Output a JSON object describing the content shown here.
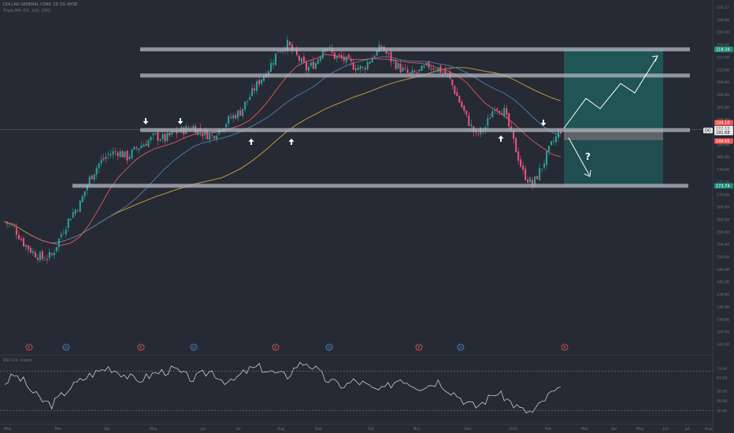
{
  "header": {
    "symbol_line": "DOLLAR GENERAL CORP. 1D  DG  NYSE",
    "indicator_line": "Triple MA  (50, 100, 200)"
  },
  "rsi_header": "RSI  (14, close)",
  "colors": {
    "background": "#262a34",
    "up": "#26a69a",
    "down": "#ef5381",
    "ma50": "#e05a5a",
    "ma100": "#4a7fb5",
    "ma200": "#d4a03c",
    "zone": "#1f5a58",
    "level_band": "#b4b8c0",
    "arrow": "#ffffff"
  },
  "price_axis_ticks": [
    "232.17",
    "228.00",
    "224.00",
    "220.00",
    "217.00",
    "213.00",
    "209.00",
    "205.00",
    "201.00",
    "198.00",
    "190.00",
    "186.00",
    "182.00",
    "179.00",
    "175.00",
    "170.00",
    "166.00",
    "162.00",
    "158.00",
    "154.00",
    "150.00",
    "146.00",
    "142.00",
    "138.00",
    "134.00",
    "130.00",
    "126.00",
    "122.00"
  ],
  "price_labels": [
    {
      "text": "218.34",
      "kind": "green"
    },
    {
      "text": "194.10",
      "kind": "red"
    },
    {
      "text": "192.16",
      "kind": "light"
    },
    {
      "text": "DG",
      "kind": "light"
    },
    {
      "text": "191.96",
      "kind": "light"
    },
    {
      "text": "191.68",
      "kind": "light"
    },
    {
      "text": "188.65",
      "kind": "red"
    },
    {
      "text": "173.74",
      "kind": "green"
    }
  ],
  "rsi_axis_ticks": [
    "73.00",
    "63.50",
    "50.00",
    "40.00",
    "30.00"
  ],
  "time_axis_ticks": [
    "May",
    "Mar",
    "Apr",
    "May",
    "Jun",
    "Jul",
    "Aug",
    "Sep",
    "Oct",
    "Nov",
    "Dec",
    "2021",
    "Feb",
    "Mar",
    "Apr",
    "May",
    "Jun",
    "Jul",
    "Aug"
  ],
  "event_markers": [
    "E",
    "D",
    "E",
    "D",
    "E",
    "D",
    "E",
    "D",
    "E"
  ],
  "question_mark": "?",
  "chart_data": {
    "type": "candlestick",
    "title": "DOLLAR GENERAL CORP. 1D",
    "series": [
      {
        "name": "DG",
        "close": [
          162,
          160,
          155,
          152,
          150,
          151,
          158,
          164,
          168,
          176,
          181,
          184,
          185,
          183,
          186,
          188,
          190,
          189,
          191,
          192,
          193,
          191,
          190,
          193,
          196,
          198,
          203,
          208,
          212,
          218,
          220,
          216,
          212,
          214,
          220,
          216,
          215,
          213,
          212,
          216,
          219,
          215,
          212,
          210,
          211,
          213,
          212,
          210,
          203,
          196,
          190,
          193,
          200,
          198,
          188,
          178,
          174,
          180,
          187,
          192
        ]
      },
      {
        "name": "MA 50"
      },
      {
        "name": "MA 100"
      },
      {
        "name": "MA 200"
      },
      {
        "name": "RSI",
        "values": [
          58,
          66,
          60,
          48,
          40,
          36,
          45,
          54,
          60,
          66,
          70,
          74,
          70,
          65,
          60,
          64,
          68,
          70,
          72,
          66,
          62,
          67,
          70,
          62,
          58,
          66,
          72,
          74,
          70,
          67,
          65,
          76,
          79,
          72,
          62,
          58,
          55,
          60,
          58,
          52,
          50,
          57,
          63,
          58,
          54,
          56,
          60,
          52,
          46,
          38,
          34,
          40,
          48,
          44,
          36,
          30,
          28,
          38,
          48,
          50
        ]
      }
    ],
    "levels": [
      218.34,
      209.8,
      191.96,
      173.74
    ],
    "yrange": [
      122,
      232.17
    ],
    "rsi_range": [
      20,
      80
    ]
  }
}
